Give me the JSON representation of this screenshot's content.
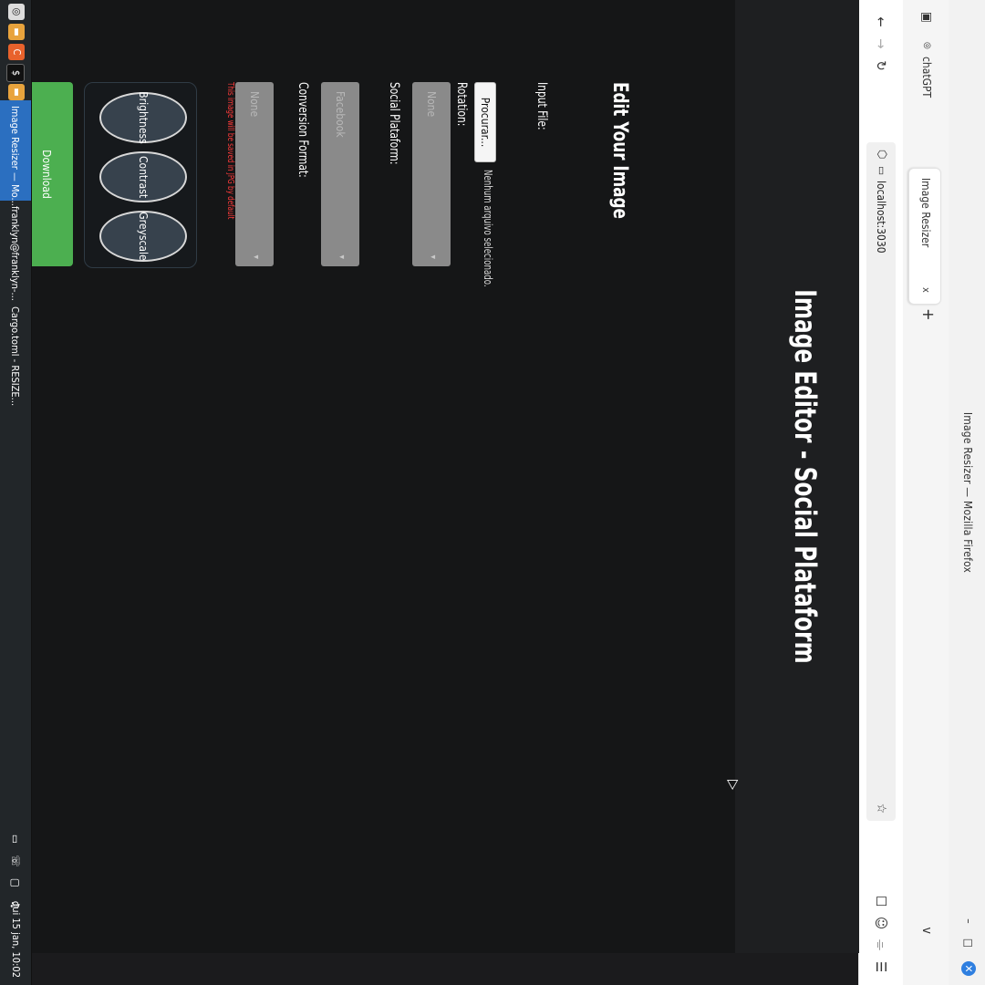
{
  "window": {
    "title": "Image Resizer — Mozilla Firefox",
    "controls": {
      "minimize": "–",
      "maximize": "□",
      "close": "✕"
    }
  },
  "tabs": {
    "pinned_label": "chatGPT",
    "items": [
      {
        "label": "Image Resizer",
        "close": "x"
      }
    ],
    "first_close": "x",
    "new_tab": "+",
    "list_all": "v"
  },
  "nav": {
    "back": "←",
    "forward": "→",
    "reload": "↻",
    "url": "localhost:3030",
    "star": "☆",
    "toolbar_icons": [
      "☐",
      "☺",
      "⌯",
      "☰"
    ]
  },
  "page": {
    "title": "Image Editor - Social Plataform",
    "edit_title": "Edit Your Image",
    "input_file_label": "Input File:",
    "file_button": "Procurar...",
    "file_status": "Nenhum arquivo selecionado.",
    "rotation_label": "Rotation:",
    "rotation_value": "None",
    "social_label": "Social Plataform:",
    "social_value": "Facebook",
    "conversion_label": "Conversion Format:",
    "conversion_value": "None",
    "note": "This image will be saved in JPG by default",
    "filters": [
      "Brightness",
      "Contrast",
      "Greyscale"
    ],
    "download": "Download"
  },
  "taskbar": {
    "tasks": [
      {
        "label": "Image Resizer — Mo...",
        "active": true
      },
      {
        "label": "franklyn@franklyn-...",
        "active": false
      },
      {
        "label": "Cargo.toml - RESIZE...",
        "active": false
      }
    ],
    "clock": "qui 15 jan, 10:02"
  },
  "colors": {
    "page_bg": "#151617",
    "header_bg": "#1e1f21",
    "select_bg": "#8a8a8a",
    "download_bg": "#4caf50",
    "note": "#ff3b3b",
    "taskbar_active": "#2b6fc0"
  }
}
